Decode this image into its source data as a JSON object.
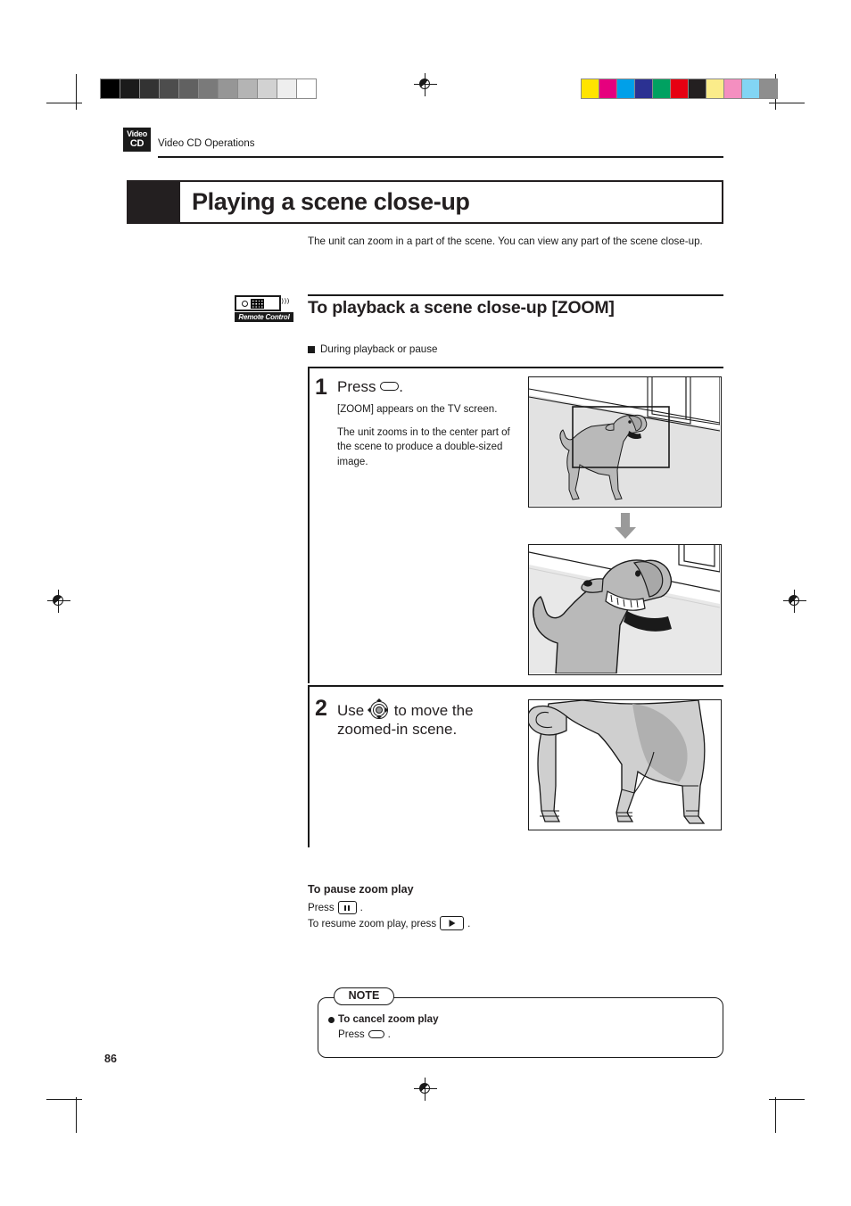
{
  "document": {
    "page_number": "86",
    "header_label": "Video CD Operations",
    "logo": {
      "line1": "Video",
      "line2": "CD"
    }
  },
  "title": {
    "heading": "Playing a scene close-up",
    "intro": "The unit can zoom in a part of the scene.  You can view any part of the scene close-up."
  },
  "section": {
    "badge_caption": "Remote Control",
    "heading": "To playback a scene close-up  [ZOOM]",
    "subhead": "During playback or pause"
  },
  "steps": [
    {
      "number": "1",
      "head_before_icon": "Press",
      "icon": "zoom-key-pill",
      "head_after_icon": ".",
      "paragraphs": [
        "[ZOOM] appears on the TV screen.",
        "The unit zooms in to the center part of the scene to produce a double-sized image."
      ]
    },
    {
      "number": "2",
      "head_before_icon": "Use",
      "icon": "cursor-dpad",
      "head_after_icon": "to move the zoomed-in scene.",
      "paragraphs": []
    }
  ],
  "pause_section": {
    "heading": "To pause zoom play",
    "line1_before": "Press",
    "line1_icon": "pause-key",
    "line1_after": ".",
    "line2_before": "To resume zoom play, press",
    "line2_icon": "play-key",
    "line2_after": "."
  },
  "note": {
    "tab_label": "NOTE",
    "title": "To cancel zoom play",
    "text_before_icon": "Press",
    "icon": "zoom-key-pill",
    "text_after_icon": "."
  },
  "figures": [
    {
      "name": "figure-normal-scene-with-zoom-frame",
      "caption": "Dog standing in a room, rectangle marks the area to be zoomed"
    },
    {
      "name": "figure-zoomed-scene",
      "caption": "Zoomed view of the dog's head and shoulders"
    },
    {
      "name": "figure-panned-scene",
      "caption": "Zoomed view panned to the dog's hind legs"
    }
  ],
  "print_marks": {
    "grayscale_swatches": [
      "#000000",
      "#1b1b1b",
      "#333333",
      "#4d4d4d",
      "#616161",
      "#7a7a7a",
      "#969696",
      "#b4b4b4",
      "#d2d2d2",
      "#eeeeee",
      "#ffffff"
    ],
    "color_swatches": [
      "#ffe400",
      "#e6007e",
      "#00a0e9",
      "#2b3192",
      "#00a161",
      "#e60012",
      "#231f20",
      "#fbec8a",
      "#f48fc0",
      "#82d5f4",
      "#8e8e8e"
    ]
  },
  "colors": {
    "ink": "#1a1a1a",
    "banner_black": "#231f20",
    "figure_fill": "#b9b9b9",
    "figure_shadow": "#9e9e9e",
    "arrow_gray": "#9a9a9a"
  }
}
